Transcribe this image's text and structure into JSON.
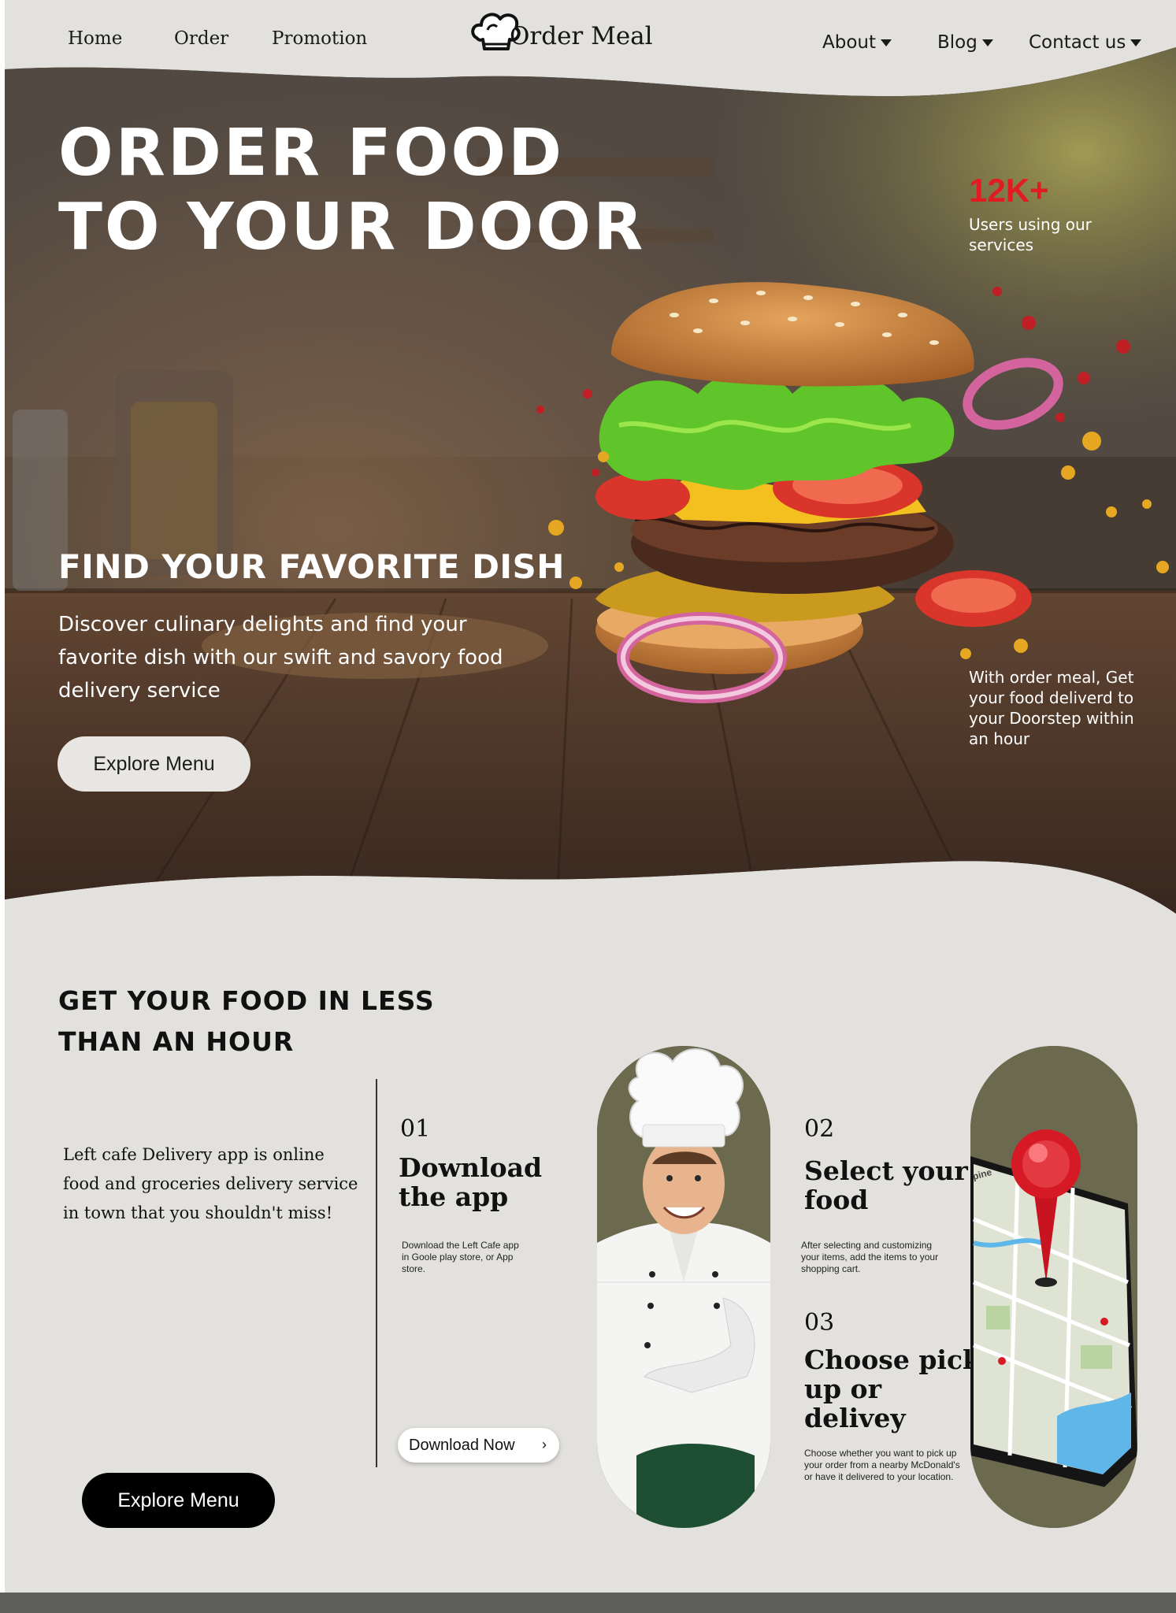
{
  "nav": {
    "left_links": [
      "Home",
      "Order",
      "Promotion"
    ],
    "logo_text": "Order Meal",
    "right_menus": [
      "About",
      "Blog",
      "Contact us"
    ]
  },
  "hero": {
    "title_line1": "ORDER FOOD",
    "title_line2": "TO YOUR DOOR",
    "stat_number": "12K+",
    "stat_text": "Users using our services",
    "subtitle": "FIND YOUR FAVORITE DISH",
    "description": "Discover culinary delights and find your favorite dish with our swift and savory food delivery service",
    "button": "Explore Menu",
    "side_note": "With order meal, Get your food deliverd to your Doorstep within an hour"
  },
  "how": {
    "title_line1": "GET YOUR FOOD IN LESS",
    "title_line2": "THAN AN HOUR",
    "description": "Left cafe Delivery app is online food and groceries delivery service in town that you shouldn't miss!",
    "steps": [
      {
        "num": "01",
        "title_l1": "Download",
        "title_l2": "the app",
        "title_l3": "",
        "text": "Download the Left Cafe app in Goole play store, or App store."
      },
      {
        "num": "02",
        "title_l1": "Select your",
        "title_l2": "food",
        "title_l3": "",
        "text": "After selecting and customizing your items, add the items to your shopping cart."
      },
      {
        "num": "03",
        "title_l1": "Choose pick",
        "title_l2": "up or",
        "title_l3": "delivey",
        "text": "Choose whether you want to pick up your order from a nearby McDonald's or have it delivered to your location."
      }
    ],
    "download_button": "Download Now",
    "explore_button": "Explore Menu",
    "phone_screen_text": "pine"
  },
  "colors": {
    "page_bg": "#e2e1de",
    "hero_dark": "#4a3f36",
    "accent_red": "#e21b23",
    "pill_olive": "#6b6a4f"
  }
}
